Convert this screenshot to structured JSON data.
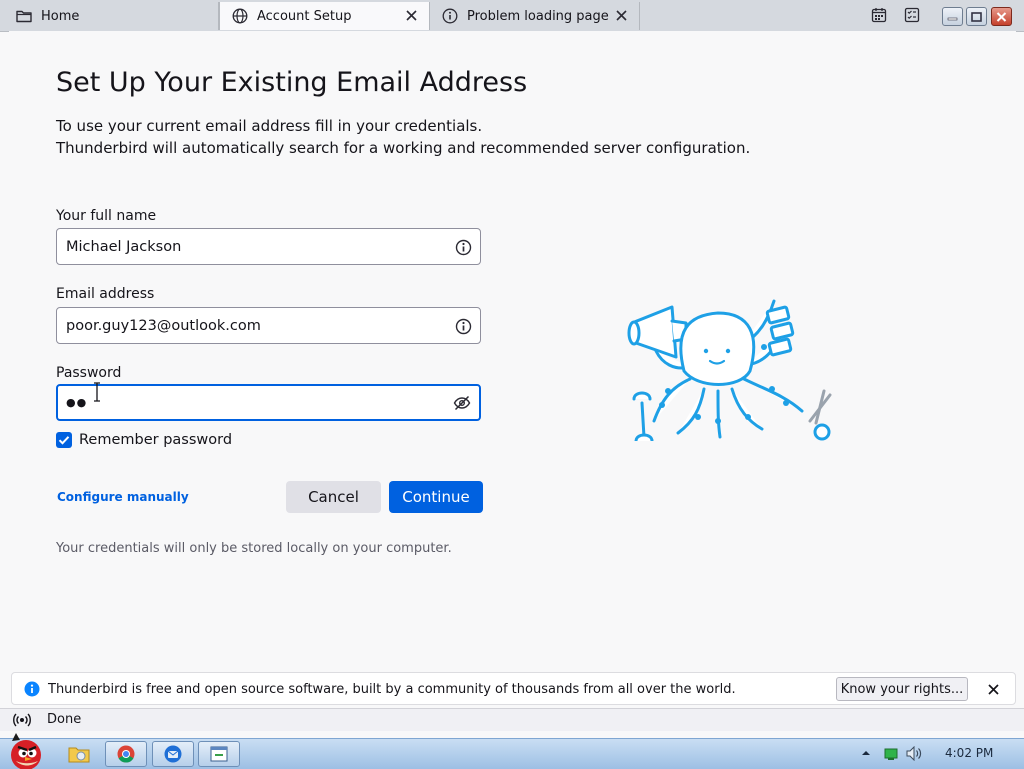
{
  "tabs": [
    {
      "label": "Home",
      "icon": "folder-icon"
    },
    {
      "label": "Account Setup",
      "icon": "globe-icon",
      "active": true
    },
    {
      "label": "Problem loading page",
      "icon": "info-icon"
    }
  ],
  "toolbar_icons": [
    "calendar-icon",
    "tasks-icon"
  ],
  "window_controls": [
    "minimize",
    "maximize",
    "close"
  ],
  "setup": {
    "title": "Set Up Your Existing Email Address",
    "description_line1": "To use your current email address fill in your credentials.",
    "description_line2": "Thunderbird will automatically search for a working and recommended server configuration.",
    "fullname_label": "Your full name",
    "fullname_value": "Michael Jackson",
    "email_label": "Email address",
    "email_value": "poor.guy123@outlook.com",
    "password_label": "Password",
    "password_masked": "●●",
    "remember_label": "Remember password",
    "remember_checked": true,
    "configure_manually": "Configure manually",
    "cancel": "Cancel",
    "continue": "Continue",
    "privacy_note": "Your credentials will only be stored locally on your computer."
  },
  "notification": {
    "text": "Thunderbird is free and open source software, built by a community of thousands from all over the world.",
    "button": "Know your rights..."
  },
  "statusbar": {
    "text": "Done"
  },
  "taskbar": {
    "apps": [
      "windows-explorer",
      "google-chrome",
      "thunderbird",
      "window"
    ],
    "clock": "4:02 PM"
  },
  "colors": {
    "accent": "#0061e0",
    "tab_strip": "#d5d9df",
    "content_bg": "#f8f8f9",
    "mascot_blue": "#1ea0e6",
    "taskbar": "#b3cde9"
  }
}
